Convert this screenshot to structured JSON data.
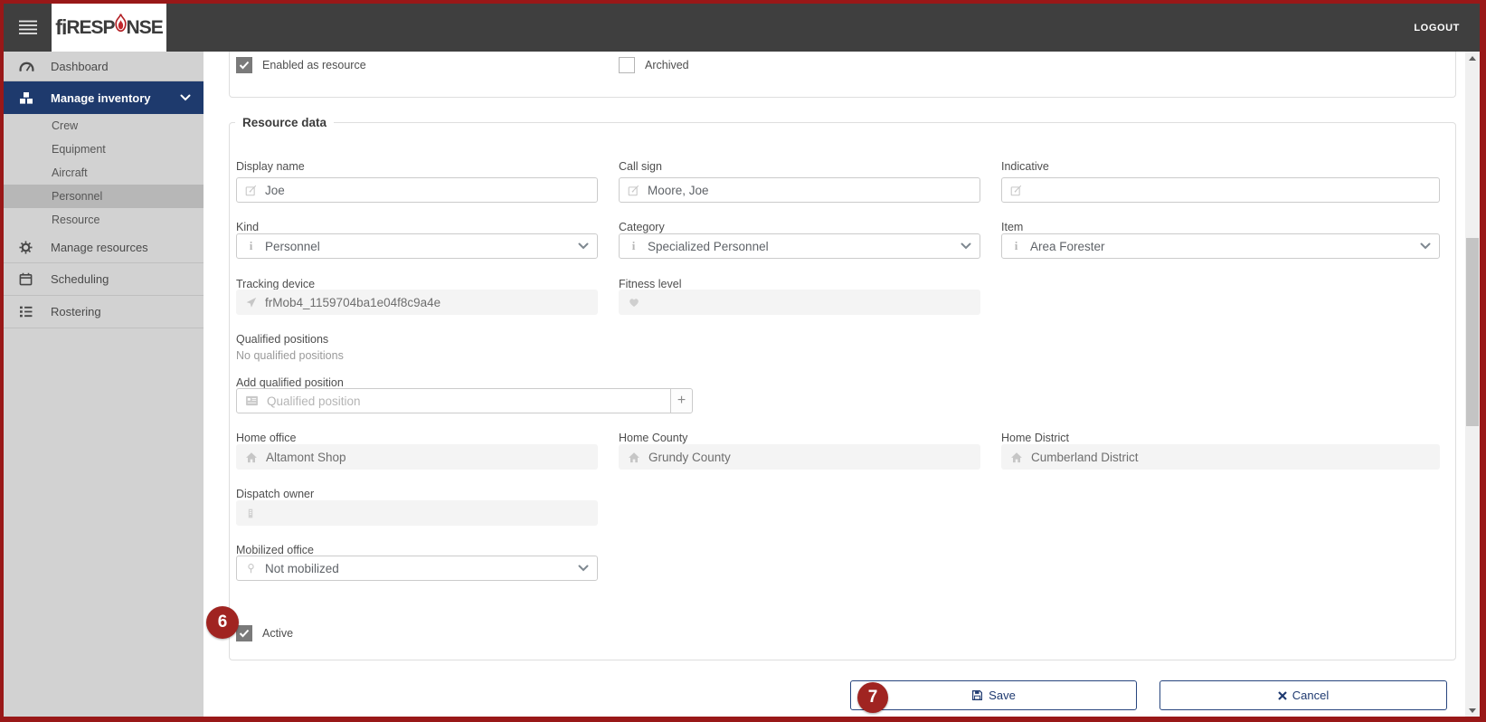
{
  "colors": {
    "frame_border": "#991818",
    "header_bg": "#3f3f3f",
    "sidebar_bg": "#d2d2d2",
    "sidebar_active_bg": "#1e3a6d",
    "sidebar_selected_bg": "#b7b7b7",
    "badge_bg": "#a02421",
    "accent_navy": "#1f3a70",
    "logo_flame_red": "#c1272d"
  },
  "header": {
    "logo_fi": "fi",
    "logo_resp": "RESP",
    "logo_nse": "NSE",
    "logout_label": "LOGOUT"
  },
  "sidebar": {
    "dashboard": {
      "label": "Dashboard"
    },
    "manage_inventory": {
      "label": "Manage inventory",
      "expanded": true,
      "active": true
    },
    "subitems": {
      "crew": "Crew",
      "equipment": "Equipment",
      "aircraft": "Aircraft",
      "personnel": "Personnel",
      "resource": "Resource"
    },
    "selected_subitem": "Personnel",
    "manage_resources": {
      "label": "Manage resources"
    },
    "scheduling": {
      "label": "Scheduling"
    },
    "rostering": {
      "label": "Rostering"
    }
  },
  "top_section": {
    "enabled_as_resource": {
      "label": "Enabled as resource",
      "checked": true
    },
    "archived": {
      "label": "Archived",
      "checked": false
    }
  },
  "form": {
    "legend": "Resource data",
    "fields": {
      "display_name": {
        "label": "Display name",
        "value": "Joe"
      },
      "call_sign": {
        "label": "Call sign",
        "value": "Moore, Joe"
      },
      "indicative": {
        "label": "Indicative",
        "value": ""
      },
      "kind": {
        "label": "Kind",
        "value": "Personnel"
      },
      "category": {
        "label": "Category",
        "value": "Specialized Personnel"
      },
      "item": {
        "label": "Item",
        "value": "Area Forester"
      },
      "tracking_device": {
        "label": "Tracking device",
        "value": "frMob4_1159704ba1e04f8c9a4e",
        "disabled": true
      },
      "fitness_level": {
        "label": "Fitness level",
        "value": "",
        "disabled": true
      },
      "qualified_positions": {
        "label": "Qualified positions",
        "empty_text": "No qualified positions"
      },
      "add_qualified_position": {
        "label": "Add qualified position",
        "placeholder": "Qualified position"
      },
      "home_office": {
        "label": "Home office",
        "value": "Altamont Shop",
        "disabled": true
      },
      "home_county": {
        "label": "Home County",
        "value": "Grundy County",
        "disabled": true
      },
      "home_district": {
        "label": "Home District",
        "value": "Cumberland District",
        "disabled": true
      },
      "dispatch_owner": {
        "label": "Dispatch owner",
        "value": "",
        "disabled": true
      },
      "mobilized_office": {
        "label": "Mobilized office",
        "value": "Not mobilized"
      },
      "active": {
        "label": "Active",
        "checked": true
      }
    }
  },
  "badges": {
    "active_checkbox": "6",
    "save_button": "7"
  },
  "actions": {
    "save_label": "Save",
    "cancel_label": "Cancel"
  },
  "icons": {
    "info": "i",
    "plus": "+",
    "named_svg_icons": [
      "menu-icon",
      "flame-icon",
      "dashboard-icon",
      "cubes-icon",
      "gear-icon",
      "calendar-icon",
      "list-icon",
      "chevron-down-icon",
      "checkmark-icon",
      "edit-icon",
      "location-arrow-icon",
      "heart-icon",
      "id-card-icon",
      "home-icon",
      "building-icon",
      "pin-icon",
      "save-icon",
      "cancel-x-icon",
      "scroll-up-icon",
      "scroll-down-icon"
    ]
  }
}
